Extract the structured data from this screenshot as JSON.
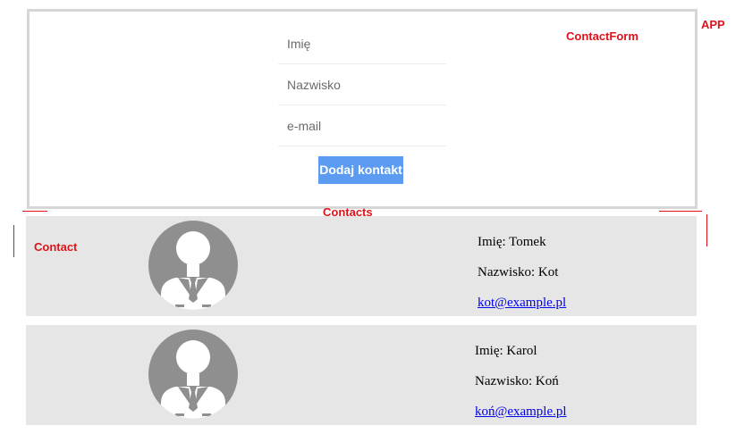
{
  "labels": {
    "app": "APP",
    "contact_form": "ContactForm",
    "contacts": "Contacts",
    "contact": "Contact"
  },
  "form": {
    "first_name_placeholder": "Imię",
    "last_name_placeholder": "Nazwisko",
    "email_placeholder": "e-mail",
    "submit_label": "Dodaj kontakt"
  },
  "contacts": [
    {
      "name_line": "Imię: Tomek",
      "surname_line": "Nazwisko: Kot",
      "email": "kot@example.pl"
    },
    {
      "name_line": "Imię: Karol",
      "surname_line": "Nazwisko: Koń",
      "email": "koń@example.pl"
    }
  ],
  "colors": {
    "annotation": "#e0121b",
    "button": "#5b9bf2",
    "card_bg": "#e6e6e6",
    "avatar": "#8f8f8f"
  }
}
